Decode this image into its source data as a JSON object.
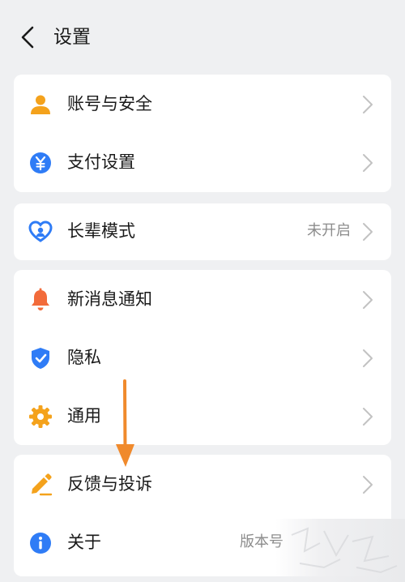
{
  "header": {
    "title": "设置",
    "back_icon": "chevron-left-icon"
  },
  "groups": [
    {
      "items": [
        {
          "label": "账号与安全",
          "icon": "person-icon",
          "icon_color": "#f4a21c",
          "value": ""
        },
        {
          "label": "支付设置",
          "icon": "yuan-icon",
          "icon_color": "#2f7cf6",
          "value": ""
        }
      ]
    },
    {
      "items": [
        {
          "label": "长辈模式",
          "icon": "heart-icon",
          "icon_color": "#2f7cf6",
          "value": "未开启"
        }
      ]
    },
    {
      "items": [
        {
          "label": "新消息通知",
          "icon": "bell-icon",
          "icon_color": "#f26b3a",
          "value": ""
        },
        {
          "label": "隐私",
          "icon": "shield-icon",
          "icon_color": "#2f7cf6",
          "value": ""
        },
        {
          "label": "通用",
          "icon": "gear-icon",
          "icon_color": "#f4a21c",
          "value": ""
        }
      ]
    },
    {
      "items": [
        {
          "label": "反馈与投诉",
          "icon": "pencil-icon",
          "icon_color": "#f4a21c",
          "value": ""
        },
        {
          "label": "关于",
          "icon": "info-icon",
          "icon_color": "#2f7cf6",
          "value": "版本号"
        }
      ]
    }
  ],
  "annotation": {
    "arrow_color": "#f08a2c",
    "icon": "down-arrow-annotation-icon"
  },
  "colors": {
    "background": "#eff0f2",
    "card": "#ffffff",
    "chevron": "#c2c2c2",
    "value_text": "#8c8c8c"
  }
}
